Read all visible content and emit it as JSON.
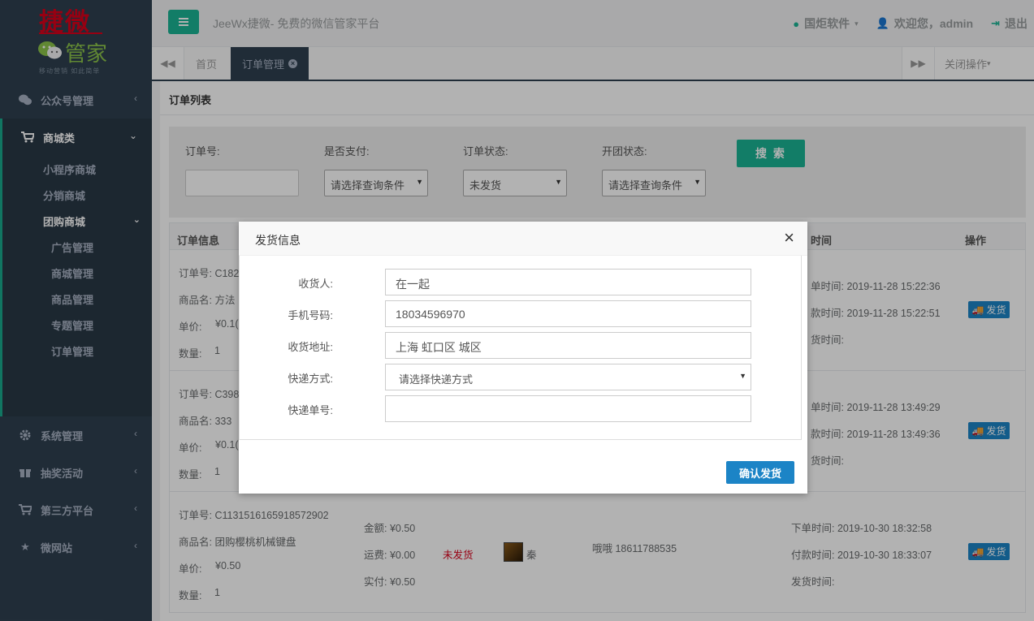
{
  "logo": {
    "line1": "捷微",
    "line2": "管家",
    "slogan": "移动营销 如此简单"
  },
  "header": {
    "site_title": "JeeWx捷微- 免费的微信管家平台",
    "vendor": "国炬软件",
    "welcome": "欢迎您，admin",
    "logout": "退出"
  },
  "tabs": {
    "home": "首页",
    "active": "订单管理",
    "close_ops": "关闭操作"
  },
  "sidebar": {
    "wechat": "公众号管理",
    "mall": "商城类",
    "mall_sub": [
      "小程序商城",
      "分销商城",
      "团购商城"
    ],
    "group_sub": [
      "广告管理",
      "商城管理",
      "商品管理",
      "专题管理",
      "订单管理"
    ],
    "system": "系统管理",
    "lottery": "抽奖活动",
    "third": "第三方平台",
    "micro": "微网站"
  },
  "page": {
    "title": "订单列表"
  },
  "search": {
    "order_no_label": "订单号:",
    "paid_label": "是否支付:",
    "paid_value": "请选择查询条件",
    "status_label": "订单状态:",
    "status_value": "未发货",
    "group_label": "开团状态:",
    "group_value": "请选择查询条件",
    "button": "搜 索"
  },
  "table": {
    "col_info": "订单信息",
    "col_time": "时间",
    "col_op": "操作",
    "send_label": "发货",
    "rows": [
      {
        "order_no": "订单号: C1825",
        "goods": "商品名: 方法",
        "price_label": "单价:",
        "price": "¥0.1(",
        "qty_label": "数量:",
        "qty": "1",
        "order_time": "单时间: 2019-11-28 15:22:36",
        "pay_time": "款时间: 2019-11-28 15:22:51",
        "ship_time": "货时间:"
      },
      {
        "order_no": "订单号: C398(",
        "goods": "商品名: 333",
        "price_label": "单价:",
        "price": "¥0.1(",
        "qty_label": "数量:",
        "qty": "1",
        "order_time": "单时间: 2019-11-28 13:49:29",
        "pay_time": "款时间: 2019-11-28 13:49:36",
        "ship_time": "货时间:"
      },
      {
        "order_no": "订单号: C1131516165918572902",
        "goods": "商品名: 团购樱桃机械键盘",
        "price_label": "单价:",
        "price": "¥0.50",
        "qty_label": "数量:",
        "qty": "1",
        "amount": "金额: ¥0.50",
        "freight": "运费: ¥0.00",
        "actual": "实付: ¥0.50",
        "status": "未发货",
        "nickname": "秦",
        "receiver": "哦哦  18611788535",
        "order_time": "下单时间: 2019-10-30 18:32:58",
        "pay_time": "付款时间: 2019-10-30 18:33:07",
        "ship_time": "发货时间:"
      }
    ]
  },
  "modal": {
    "title": "发货信息",
    "receiver_label": "收货人:",
    "receiver": "在一起",
    "phone_label": "手机号码:",
    "phone": "18034596970",
    "address_label": "收货地址:",
    "address": "上海 虹口区 城区",
    "express_label": "快递方式:",
    "express_value": "请选择快递方式",
    "tracking_label": "快递单号:",
    "tracking": "",
    "confirm": "确认发货"
  },
  "colors": {
    "sidebar": "#2f4050",
    "primary": "#1ab394",
    "blue": "#1c84c6",
    "red": "#d9001b"
  }
}
